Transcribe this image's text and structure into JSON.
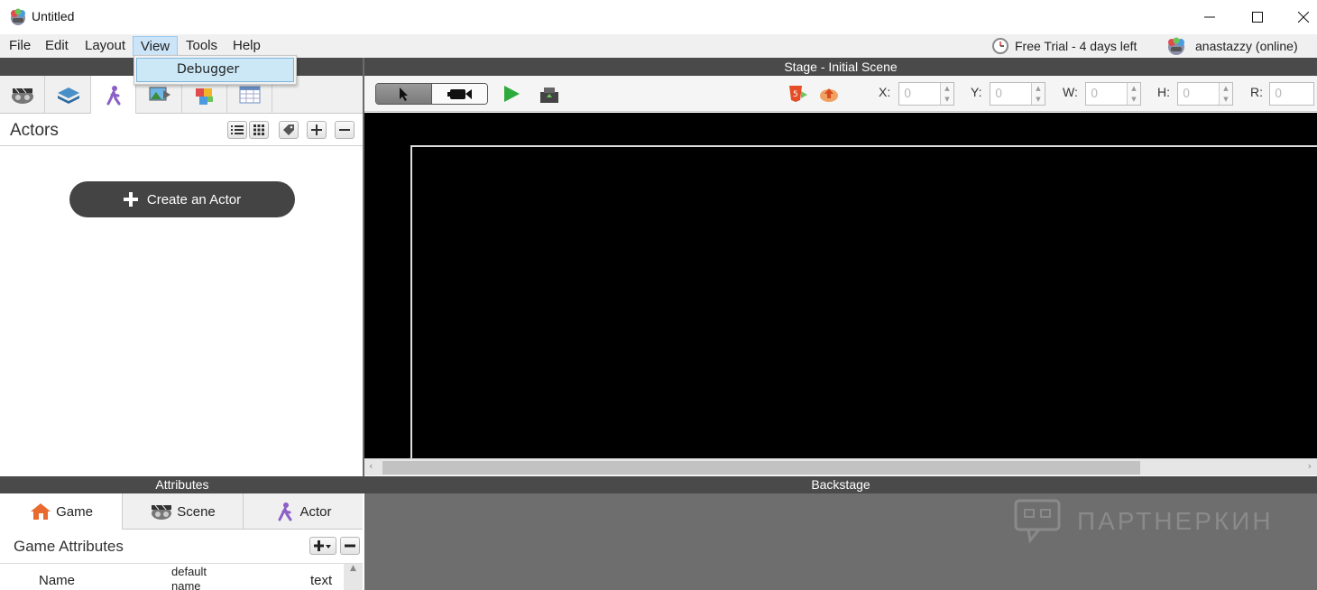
{
  "window": {
    "title": "Untitled",
    "minimize_icon": "minimize-icon",
    "maximize_icon": "maximize-icon",
    "close_icon": "close-icon"
  },
  "menubar": {
    "items": [
      "File",
      "Edit",
      "Layout",
      "View",
      "Tools",
      "Help"
    ],
    "active": "View",
    "trial": "Free Trial - 4 days left",
    "user": "anastazzy (online)"
  },
  "view_menu": {
    "items": [
      "Debugger"
    ]
  },
  "left_panel": {
    "tabs": [
      "scenes-icon",
      "layers-icon",
      "actors-icon",
      "images-icon",
      "behaviors-icon",
      "tables-icon"
    ],
    "active_tab": "actors-icon",
    "section_title": "Actors",
    "create_button": "Create an Actor"
  },
  "stage": {
    "header": "Stage - Initial Scene",
    "coords": [
      {
        "label": "X:",
        "value": "0"
      },
      {
        "label": "Y:",
        "value": "0"
      },
      {
        "label": "W:",
        "value": "0"
      },
      {
        "label": "H:",
        "value": "0"
      },
      {
        "label": "R:",
        "value": "0"
      }
    ]
  },
  "attributes": {
    "header": "Attributes",
    "tabs": [
      "Game",
      "Scene",
      "Actor"
    ],
    "active_tab": "Game",
    "title": "Game Attributes",
    "row": {
      "name": "Name",
      "default": "default name",
      "type": "text"
    }
  },
  "backstage": {
    "header": "Backstage",
    "watermark": "ПАРТНЕРКИН"
  },
  "colors": {
    "header_bg": "#4a4a4a",
    "stage_bg": "#000000",
    "backstage_bg": "#6e6e6e",
    "menu_highlight": "#cce4f7",
    "create_button_bg": "#444444"
  }
}
